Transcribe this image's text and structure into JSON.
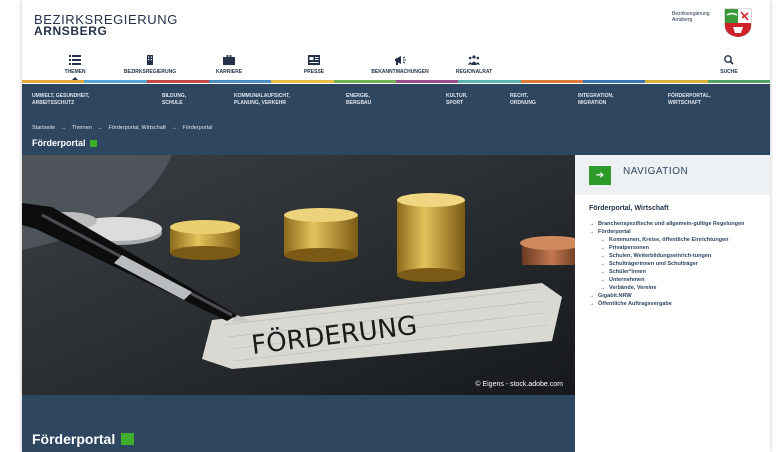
{
  "header": {
    "org_line1": "BEZIRKSREGIERUNG",
    "org_line2": "ARNSBERG",
    "crest_text_line1": "Bezirksregierung",
    "crest_text_line2": "Arnsberg"
  },
  "mainnav": {
    "items": [
      {
        "label": "THEMEN",
        "icon": "list-icon"
      },
      {
        "label": "BEZIRKSREGIERUNG",
        "icon": "building-icon"
      },
      {
        "label": "KARRIERE",
        "icon": "briefcase-icon"
      },
      {
        "label": "PRESSE",
        "icon": "newspaper-icon"
      },
      {
        "label": "BEKANNTMACHUNGEN",
        "icon": "megaphone-icon"
      },
      {
        "label": "REGIONALRAT",
        "icon": "people-icon"
      },
      {
        "label": "SUCHE",
        "icon": "search-icon"
      }
    ]
  },
  "colorbar": [
    "#e2a93b",
    "#5aa5d6",
    "#c84a48",
    "#4b8ec1",
    "#e9c046",
    "#6fb24e",
    "#9a4d8f",
    "#5bb6b0",
    "#e07a3a",
    "#3a76b4",
    "#d9b23a",
    "#55a06a"
  ],
  "topics": [
    {
      "line1": "UMWELT, GESUNDHEIT,",
      "line2": "ARBEITSSCHUTZ"
    },
    {
      "line1": "BILDUNG,",
      "line2": "SCHULE"
    },
    {
      "line1": "KOMMUNALAUFSICHT,",
      "line2": "PLANUNG, VERKEHR"
    },
    {
      "line1": "ENERGIE,",
      "line2": "BERGBAU"
    },
    {
      "line1": "KULTUR,",
      "line2": "SPORT"
    },
    {
      "line1": "RECHT,",
      "line2": "ORDNUNG"
    },
    {
      "line1": "INTEGRATION,",
      "line2": "MIGRATION"
    },
    {
      "line1": "FÖRDERPORTAL,",
      "line2": "WIRTSCHAFT"
    }
  ],
  "breadcrumb": [
    "Startseite",
    "Themen",
    "Förderportal, Wirtschaft",
    "Förderportal"
  ],
  "page_title": "Förderportal",
  "hero": {
    "sign_text": "FÖRDERUNG",
    "caption": "© Eigens - stock.adobe.com"
  },
  "bottom_title": "Förderportal",
  "sidebar": {
    "nav_label": "NAVIGATION",
    "section_title": "Förderportal, Wirtschaft",
    "items": [
      {
        "level": 1,
        "text": "Branchenspezifische und allgemein-gültige Regelungen"
      },
      {
        "level": 1,
        "text": "Förderportal"
      },
      {
        "level": 2,
        "text": "Kommunen, Kreise, öffentliche Einrichtungen"
      },
      {
        "level": 2,
        "text": "Privatpersonen"
      },
      {
        "level": 2,
        "text": "Schulen, Weiterbildungseinrich-tungen"
      },
      {
        "level": 2,
        "text": "Schulträgerinnen und Schulträger"
      },
      {
        "level": 2,
        "text": "Schüler*innen"
      },
      {
        "level": 2,
        "text": "Unternehmen"
      },
      {
        "level": 2,
        "text": "Verbände, Vereine"
      },
      {
        "level": 1,
        "text": "Gigabit.NRW"
      },
      {
        "level": 1,
        "text": "Öffentliche Auftragsvergabe"
      }
    ]
  }
}
